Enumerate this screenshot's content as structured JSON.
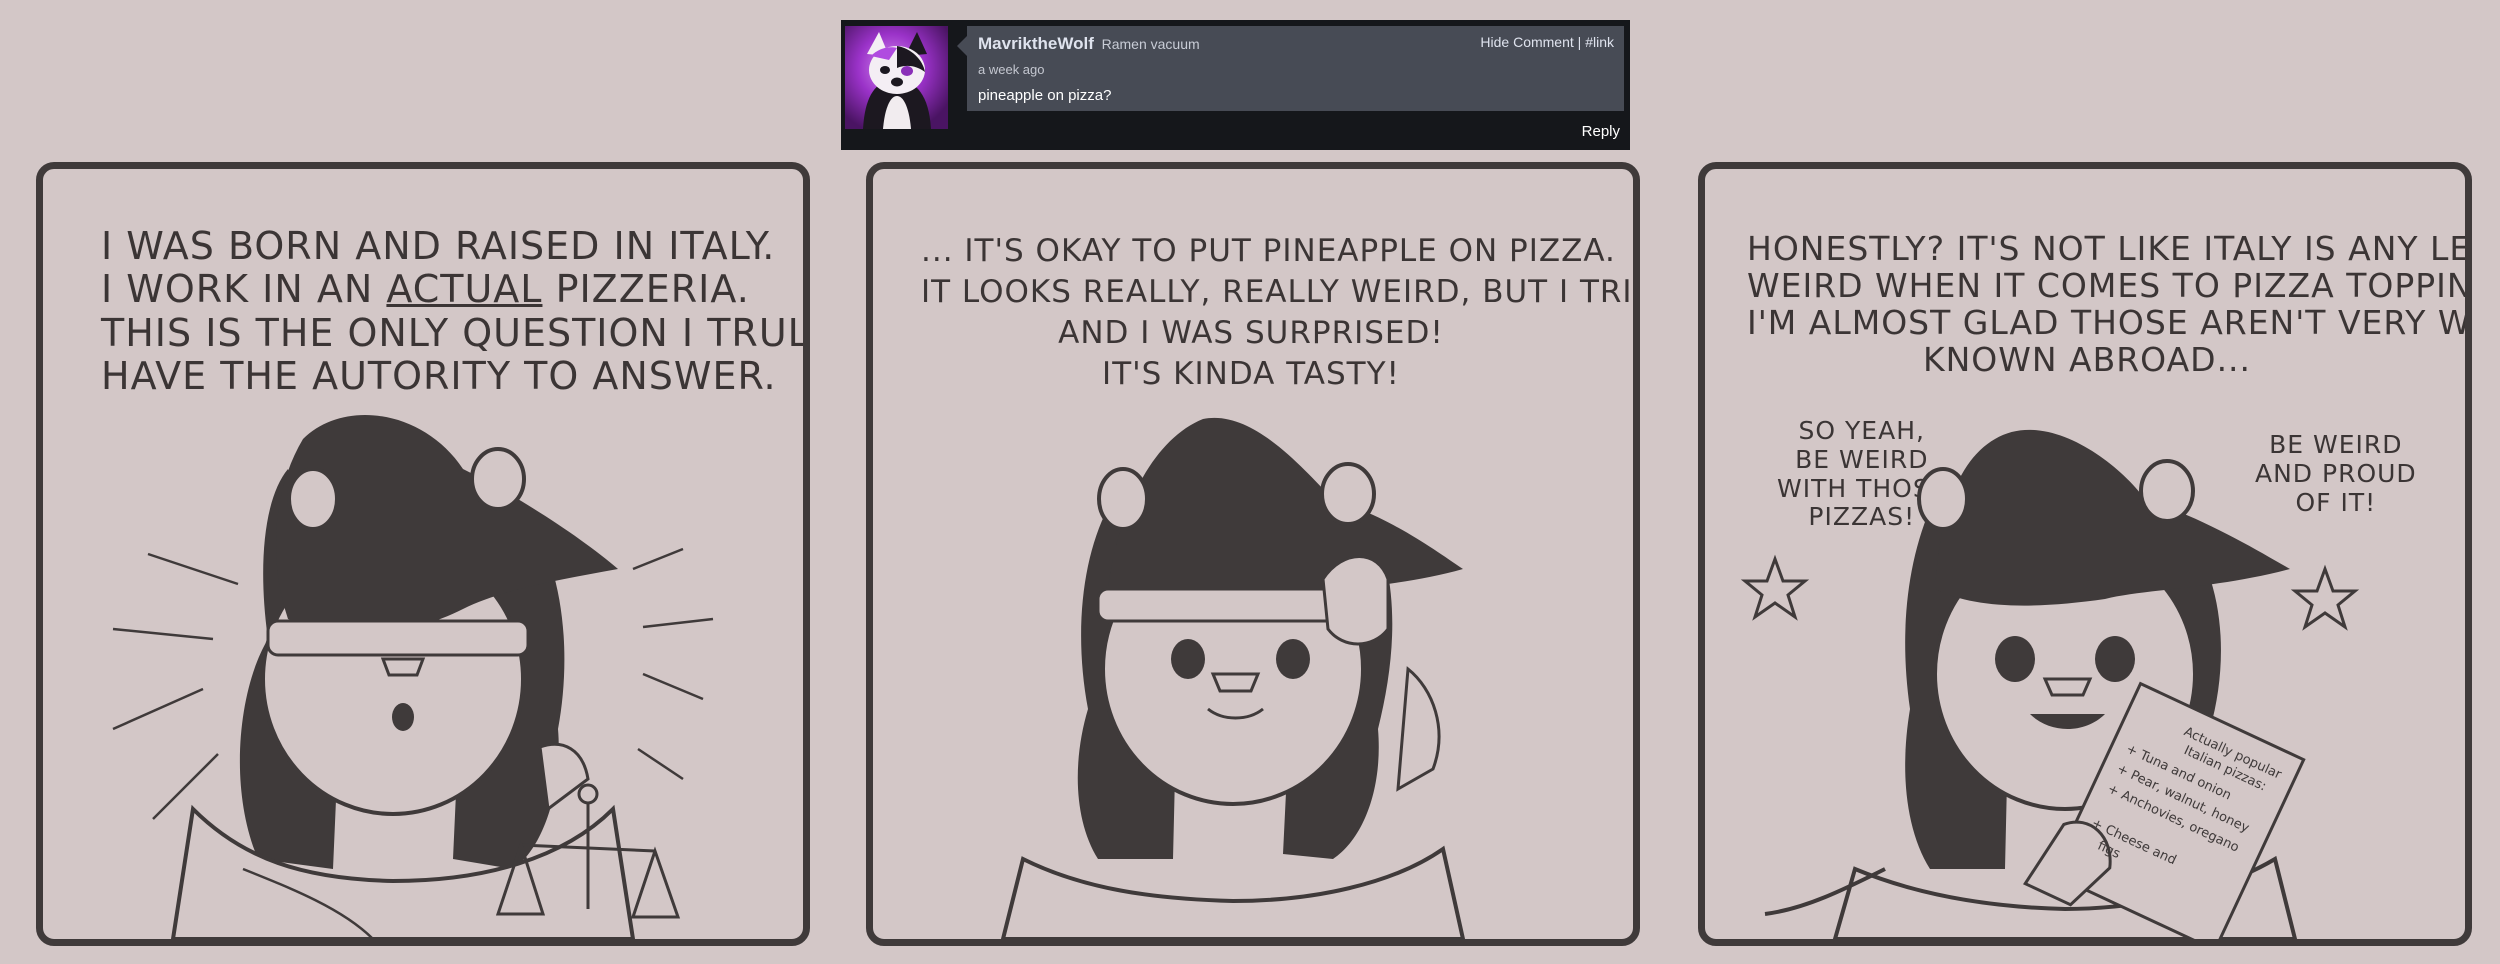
{
  "comment": {
    "author": "MavriktheWolf",
    "author_title": "Ramen vacuum",
    "time": "a week ago",
    "text": "pineapple on pizza?",
    "hide_label": "Hide Comment",
    "separator": " | ",
    "link_label": "#link",
    "reply_label": "Reply"
  },
  "panels": [
    {
      "caption": [
        "I was born and raised in Italy.",
        "I work in an",
        "actual",
        "pizzeria.",
        "This is the only question I truly",
        "have the autority to answer."
      ]
    },
    {
      "caption": [
        "... it's okay to put pineapple on pizza.",
        "It looks really, really weird, but I tried it",
        "and I was surprised!",
        "It's kinda tasty!"
      ]
    },
    {
      "caption": [
        "Honestly? It's not like Italy is any less",
        "weird when it comes to pizza toppings.",
        "I'm almost glad those aren't very well",
        "known abroad..."
      ],
      "left_bubble": [
        "So yeah,",
        "be weird",
        "with those",
        "pizzas!"
      ],
      "right_bubble": [
        "Be weird",
        "and proud",
        "of it!"
      ],
      "note": [
        "Actually popular",
        "Italian pizzas:",
        "+ Tuna and onion",
        "+ Pear, walnut, honey",
        "+ Anchovies, oregano",
        "+ Cheese and",
        "figs"
      ]
    }
  ],
  "colors": {
    "background": "#d3c7c7",
    "ink": "#3f3a3a",
    "comment_bg": "#474b55",
    "avatar_accent": "#9a32c8"
  }
}
